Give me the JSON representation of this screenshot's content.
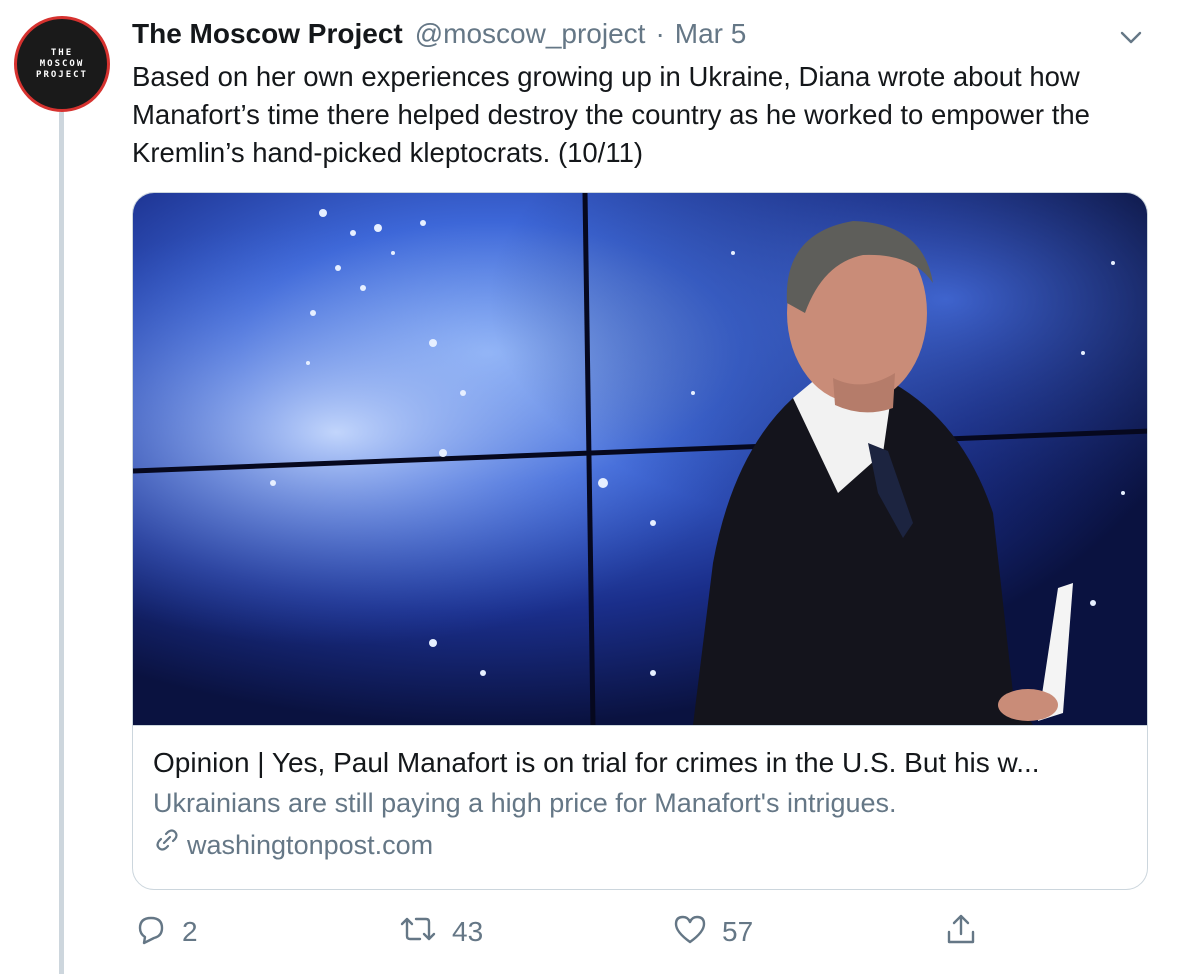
{
  "avatar": {
    "lines": [
      "THE",
      "MOSCOW",
      "PROJECT"
    ]
  },
  "tweet": {
    "display_name": "The Moscow Project",
    "handle": "@moscow_project",
    "separator": "·",
    "date": "Mar 5",
    "text": "Based on her own experiences growing up in Ukraine, Diana wrote about how Manafort’s time there helped destroy the country as he worked to empower the Kremlin’s hand-picked kleptocrats. (10/11)"
  },
  "card": {
    "title": "Opinion | Yes, Paul Manafort is on trial for crimes in the U.S. But his w...",
    "description": "Ukrainians are still paying a high price for Manafort's intrigues.",
    "domain": "washingtonpost.com"
  },
  "actions": {
    "reply_count": "2",
    "retweet_count": "43",
    "like_count": "57"
  },
  "icons": [
    "caret-down-icon",
    "reply-icon",
    "retweet-icon",
    "like-icon",
    "share-icon",
    "link-icon"
  ],
  "colors": {
    "accent_gray": "#657786",
    "border": "#ccd6dd",
    "avatar_ring": "#d6322f"
  }
}
